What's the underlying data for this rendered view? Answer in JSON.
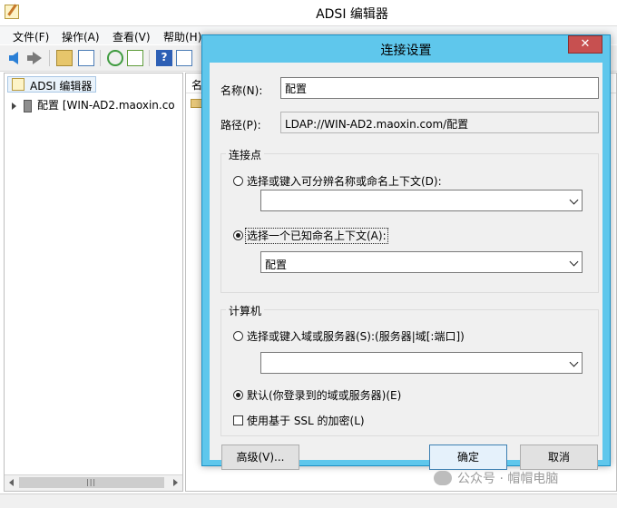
{
  "main_window": {
    "title": "ADSI 编辑器",
    "menu": [
      "文件(F)",
      "操作(A)",
      "查看(V)",
      "帮助(H)"
    ],
    "tree": {
      "root_label": "ADSI 编辑器",
      "child_label": "配置 [WIN-AD2.maoxin.co"
    },
    "right_pane_header": "名"
  },
  "dialog": {
    "title": "连接设置",
    "close_label": "✕",
    "name_label": "名称(N):",
    "name_value": "配置",
    "path_label": "路径(P):",
    "path_value": "LDAP://WIN-AD2.maoxin.com/配置",
    "connection_point": {
      "group_label": "连接点",
      "option_dn_label": "选择或键入可分辨名称或命名上下文(D):",
      "option_dn_selected": false,
      "dn_value": "",
      "option_known_label": "选择一个已知命名上下文(A):",
      "option_known_selected": true,
      "known_value": "配置"
    },
    "computer": {
      "group_label": "计算机",
      "option_server_label": "选择或键入域或服务器(S):(服务器|域[:端口])",
      "option_server_selected": false,
      "server_value": "",
      "option_default_label": "默认(你登录到的域或服务器)(E)",
      "option_default_selected": true,
      "ssl_label": "使用基于 SSL 的加密(L)",
      "ssl_checked": false
    },
    "buttons": {
      "advanced": "高级(V)...",
      "ok": "确定",
      "cancel": "取消"
    }
  },
  "watermark": "公众号 · 帽帽电脑",
  "colors": {
    "dialog_frame": "#5fc7ec",
    "close_button": "#c75050",
    "client_bg": "#f0f0f0"
  }
}
